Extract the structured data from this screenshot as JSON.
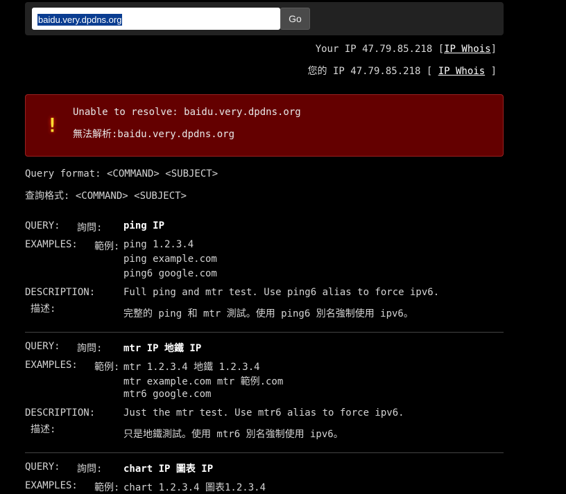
{
  "search": {
    "value": "baidu.very.dpdns.org",
    "go_label": "Go"
  },
  "ip": {
    "line_en_prefix": "Your IP 47.79.85.218 [",
    "line_en_link": "IP Whois",
    "line_en_suffix": "]",
    "line_zh_prefix": "您的 IP 47.79.85.218 [ ",
    "line_zh_link": "IP Whois",
    "line_zh_suffix": " ]"
  },
  "error": {
    "icon": "exclamation-icon",
    "line_en": "Unable to resolve: baidu.very.dpdns.org",
    "line_zh": "無法解析:baidu.very.dpdns.org"
  },
  "format": {
    "line_en": "Query format: <COMMAND> <SUBJECT>",
    "line_zh": "查詢格式: <COMMAND> <SUBJECT>"
  },
  "labels": {
    "query": "QUERY:",
    "query_zh": "詢問:",
    "examples": "EXAMPLES:",
    "examples_zh": "範例:",
    "description": "DESCRIPTION:",
    "description_zh": "描述:"
  },
  "commands": [
    {
      "query": "ping IP",
      "examples": [
        "ping 1.2.3.4",
        "ping example.com",
        "ping6 google.com"
      ],
      "desc_en": "Full ping and mtr test. Use ping6 alias to force ipv6.",
      "desc_zh": "完整的 ping 和 mtr 測試。使用 ping6 別名強制使用 ipv6。"
    },
    {
      "query": "mtr IP  地鐵 IP",
      "examples": [
        "mtr 1.2.3.4  地鐵 1.2.3.4",
        "mtr example.com  mtr 範例.com",
        "mtr6 google.com"
      ],
      "desc_en": "Just the mtr test. Use mtr6 alias to force ipv6.",
      "desc_zh": "只是地鐵測試。使用 mtr6 別名強制使用 ipv6。"
    },
    {
      "query": "chart IP  圖表 IP",
      "examples": [
        "chart 1.2.3.4  圖表1.2.3.4"
      ]
    }
  ]
}
